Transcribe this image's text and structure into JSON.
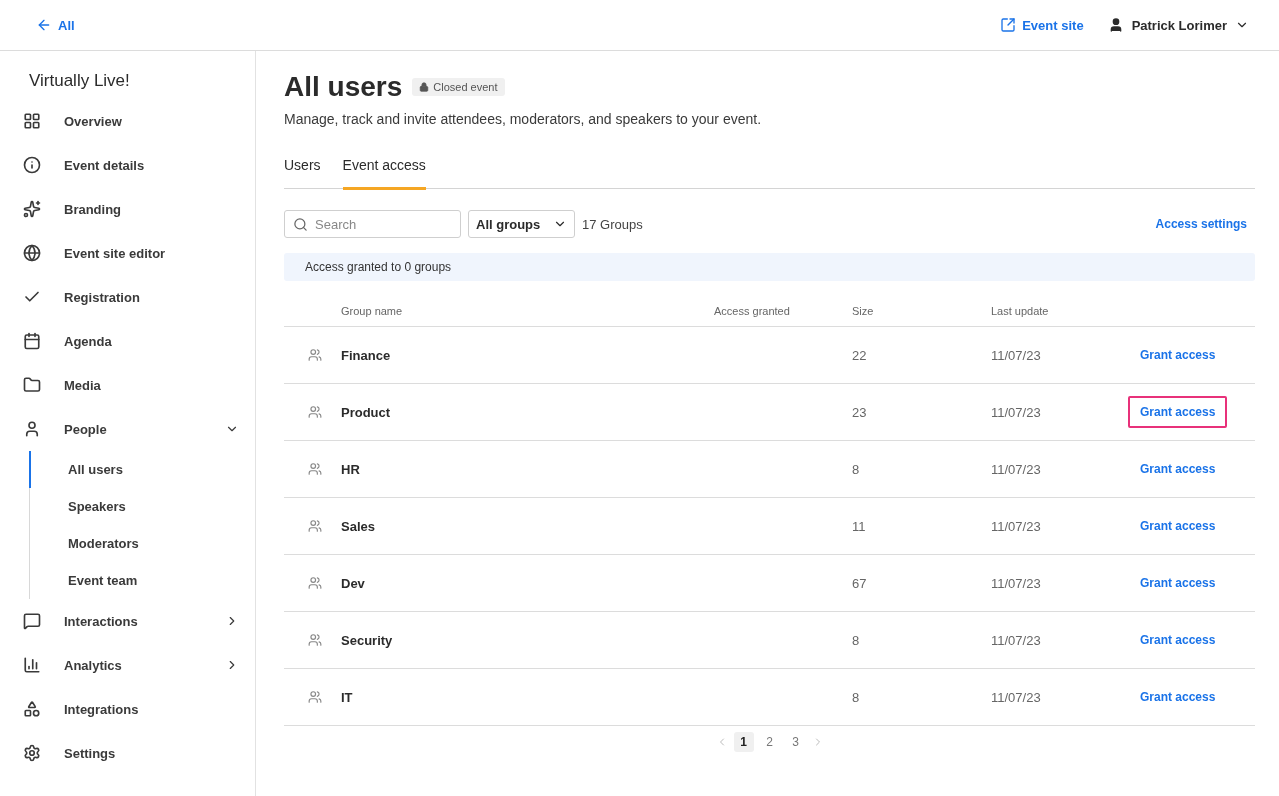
{
  "topbar": {
    "back_link": "All",
    "event_site_link": "Event site",
    "user_name": "Patrick Lorimer"
  },
  "sidebar": {
    "title": "Virtually Live!",
    "items": [
      {
        "label": "Overview",
        "selected": false
      },
      {
        "label": "Event details",
        "selected": false
      },
      {
        "label": "Branding",
        "selected": false
      },
      {
        "label": "Event site editor",
        "selected": false
      },
      {
        "label": "Registration",
        "selected": false
      },
      {
        "label": "Agenda",
        "selected": false
      },
      {
        "label": "Media",
        "selected": false
      },
      {
        "label": "People",
        "selected": false,
        "expanded": true,
        "children": [
          {
            "label": "All users",
            "selected": true
          },
          {
            "label": "Speakers",
            "selected": false
          },
          {
            "label": "Moderators",
            "selected": false
          },
          {
            "label": "Event team",
            "selected": false
          }
        ]
      },
      {
        "label": "Interactions",
        "selected": false,
        "expanded": false
      },
      {
        "label": "Analytics",
        "selected": false,
        "expanded": false
      },
      {
        "label": "Integrations",
        "selected": false
      },
      {
        "label": "Settings",
        "selected": false
      }
    ]
  },
  "page": {
    "title": "All users",
    "badge": "Closed event",
    "description": "Manage, track and invite attendees, moderators, and speakers to your event."
  },
  "tabs": [
    {
      "label": "Users",
      "selected": false
    },
    {
      "label": "Event access",
      "selected": true
    }
  ],
  "toolbar": {
    "search": {
      "placeholder": "Search"
    },
    "group_filter": "All groups",
    "group_count": "17 Groups",
    "access_settings_link": "Access settings"
  },
  "info_banner": "Access granted to 0 groups",
  "table": {
    "columns": [
      "Group name",
      "Access granted",
      "Size",
      "Last update"
    ],
    "rows": [
      {
        "name": "Finance",
        "size": "22",
        "last_update": "11/07/23",
        "action": "Grant access",
        "highlighted": false
      },
      {
        "name": "Product",
        "size": "23",
        "last_update": "11/07/23",
        "action": "Grant access",
        "highlighted": true
      },
      {
        "name": "HR",
        "size": "8",
        "last_update": "11/07/23",
        "action": "Grant access",
        "highlighted": false
      },
      {
        "name": "Sales",
        "size": "11",
        "last_update": "11/07/23",
        "action": "Grant access",
        "highlighted": false
      },
      {
        "name": "Dev",
        "size": "67",
        "last_update": "11/07/23",
        "action": "Grant access",
        "highlighted": false
      },
      {
        "name": "Security",
        "size": "8",
        "last_update": "11/07/23",
        "action": "Grant access",
        "highlighted": false
      },
      {
        "name": "IT",
        "size": "8",
        "last_update": "11/07/23",
        "action": "Grant access",
        "highlighted": false
      }
    ]
  },
  "pagination": {
    "pages": [
      {
        "label": "1",
        "selected": true
      },
      {
        "label": "2",
        "selected": false
      },
      {
        "label": "3",
        "selected": false
      }
    ]
  }
}
